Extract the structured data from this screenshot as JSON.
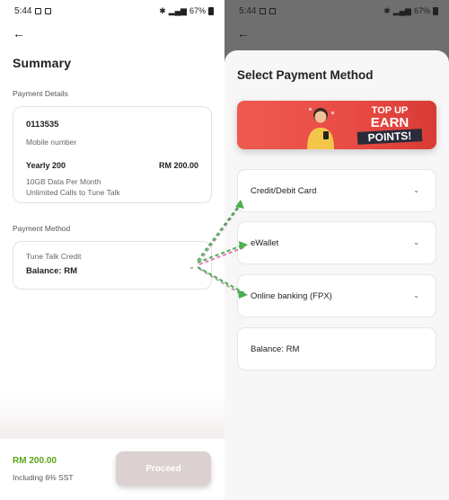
{
  "left": {
    "status": {
      "time": "5:44",
      "battery": "67%"
    },
    "title": "Summary",
    "payment_details_label": "Payment Details",
    "details": {
      "number": "0113535",
      "number_label": "Mobile number",
      "plan_name": "Yearly 200",
      "plan_price": "RM 200.00",
      "line1": "10GB Data Per Month",
      "line2": "Unlimited Calls to Tune Talk"
    },
    "payment_method_label": "Payment Method",
    "method": {
      "name": "Tune Talk Credit",
      "balance": "Balance: RM",
      "chevron": "chevron-down-icon"
    },
    "footer": {
      "total": "RM 200.00",
      "tax_note": "Including 6% SST",
      "proceed_label": "Proceed"
    }
  },
  "right": {
    "status": {
      "time": "5:44",
      "battery": "67%"
    },
    "sheet_title": "Select Payment Method",
    "banner": {
      "line1": "TOP UP",
      "line2": "EARN",
      "line3": "POINTS!"
    },
    "options": [
      {
        "label": "Credit/Debit Card"
      },
      {
        "label": "eWallet"
      },
      {
        "label": "Online banking (FPX)"
      },
      {
        "label": "Balance: RM"
      }
    ]
  },
  "colors": {
    "accent_green": "#5aa51c",
    "proceed_disabled": "#dbd1d1",
    "banner_red": "#e84b43",
    "arrow_green": "#4caf50",
    "arrow_magenta": "#e040a0"
  }
}
